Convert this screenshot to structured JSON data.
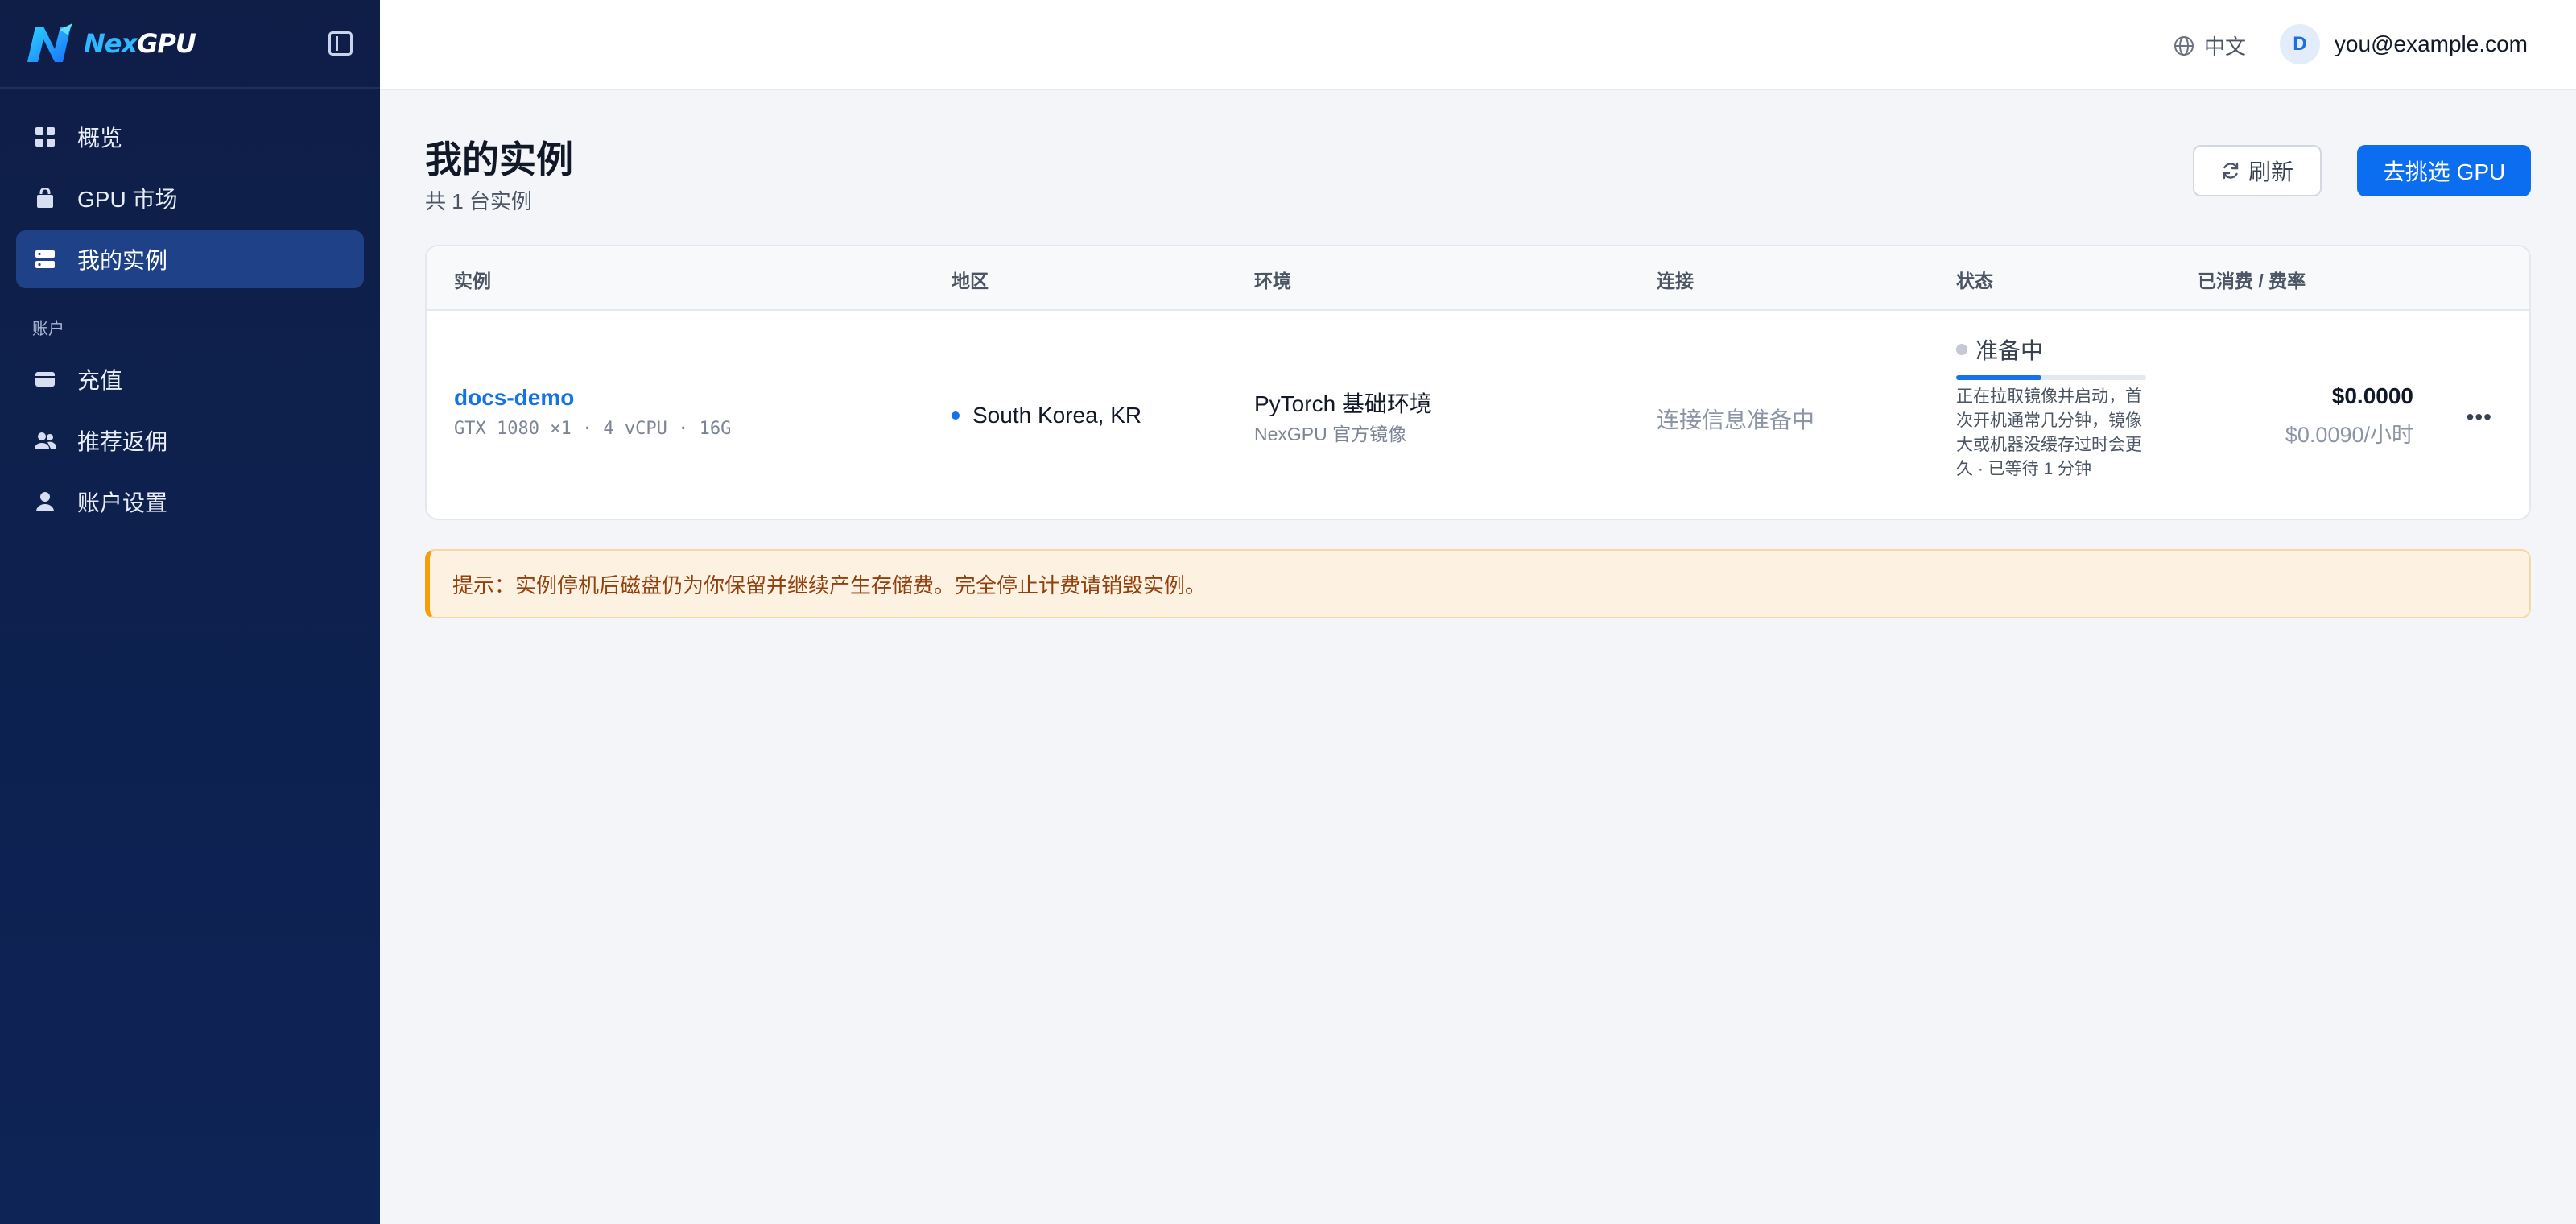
{
  "brand": {
    "name_part1": "Nex",
    "name_part2": "GPU",
    "logo_icon": "nexgpu-logo",
    "colors": {
      "accent": "#2fb8ff",
      "sidebar_bg": "#0f1e47"
    }
  },
  "sidebar": {
    "collapse_icon": "sidebar-toggle-icon",
    "items": [
      {
        "label": "概览",
        "icon": "grid-icon"
      },
      {
        "label": "GPU 市场",
        "icon": "bag-icon"
      },
      {
        "label": "我的实例",
        "icon": "server-icon",
        "active": true
      }
    ],
    "section_label": "账户",
    "account_items": [
      {
        "label": "充值",
        "icon": "card-icon"
      },
      {
        "label": "推荐返佣",
        "icon": "users-icon"
      },
      {
        "label": "账户设置",
        "icon": "user-icon"
      }
    ]
  },
  "topbar": {
    "language": "中文",
    "language_icon": "globe-icon",
    "avatar_initial": "D",
    "email": "you@example.com"
  },
  "page": {
    "title": "我的实例",
    "subtitle": "共 1 台实例",
    "refresh_label": "刷新",
    "refresh_icon": "refresh-icon",
    "primary_label": "去挑选 GPU",
    "primary_color": "#0b6ef0"
  },
  "table": {
    "headers": [
      "实例",
      "地区",
      "环境",
      "连接",
      "状态",
      "已消费 / 费率"
    ],
    "rows": [
      {
        "name": "docs-demo",
        "spec": "GTX 1080 ×1 · 4 vCPU · 16G",
        "region": "South Korea, KR",
        "env": "PyTorch 基础环境",
        "env_sub": "NexGPU 官方镜像",
        "connection": "连接信息准备中",
        "status": "准备中",
        "status_progress": 0.45,
        "status_note": "正在拉取镜像并启动，首次开机通常几分钟，镜像大或机器没缓存过时会更久 · 已等待 1 分钟",
        "cost_total": "$0.0000",
        "cost_rate": "$0.0090/小时",
        "more_icon": "ellipsis-icon"
      }
    ]
  },
  "notice": {
    "text": "提示：实例停机后磁盘仍为你保留并继续产生存储费。完全停止计费请销毁实例。",
    "color": "#f59e0b"
  }
}
